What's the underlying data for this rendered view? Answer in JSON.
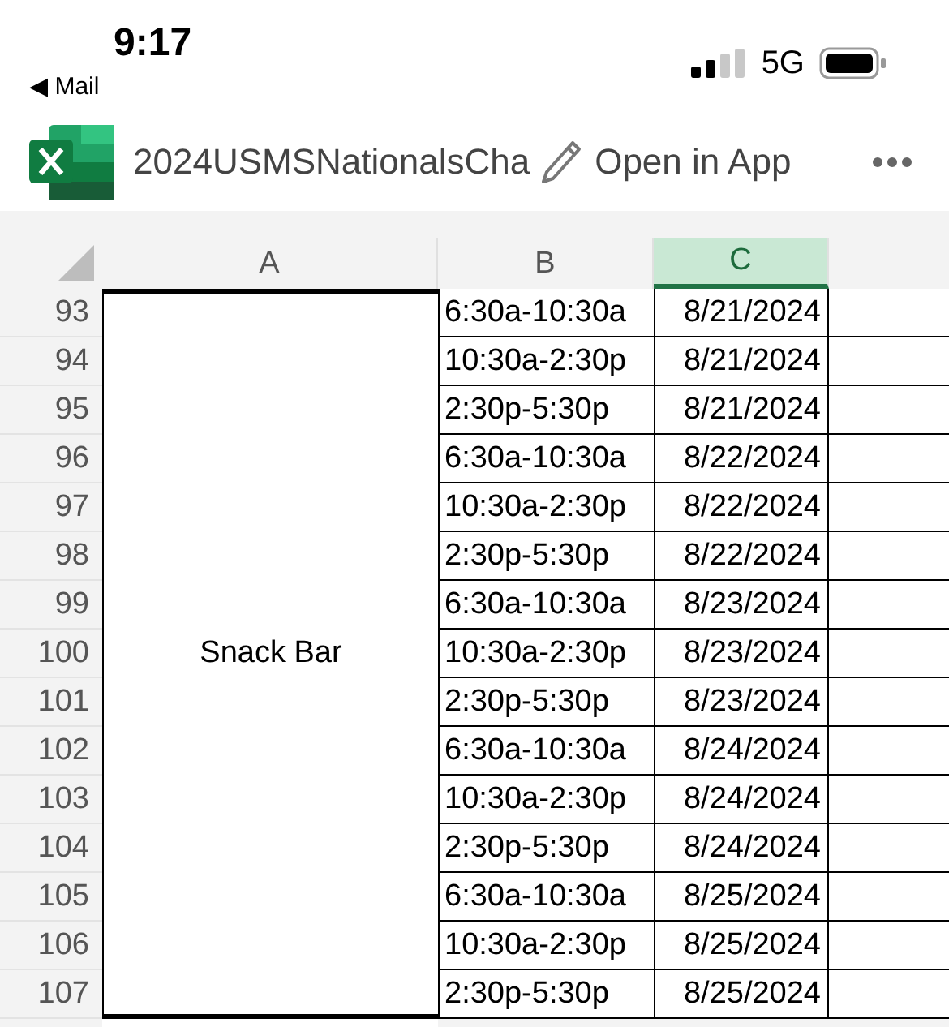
{
  "status_bar": {
    "time": "9:17",
    "back_label": "◀ Mail",
    "network": "5G"
  },
  "toolbar": {
    "title": "2024USMSNationalsCha",
    "open_button": "Open in App"
  },
  "sheet": {
    "columns": [
      {
        "label": "A",
        "selected": false
      },
      {
        "label": "B",
        "selected": false
      },
      {
        "label": "C",
        "selected": true
      }
    ],
    "merged_cell": "Snack Bar",
    "rows": [
      {
        "number": "93",
        "b": "6:30a-10:30a",
        "c": "8/21/2024"
      },
      {
        "number": "94",
        "b": "10:30a-2:30p",
        "c": "8/21/2024"
      },
      {
        "number": "95",
        "b": "2:30p-5:30p",
        "c": "8/21/2024"
      },
      {
        "number": "96",
        "b": "6:30a-10:30a",
        "c": "8/22/2024"
      },
      {
        "number": "97",
        "b": "10:30a-2:30p",
        "c": "8/22/2024"
      },
      {
        "number": "98",
        "b": "2:30p-5:30p",
        "c": "8/22/2024"
      },
      {
        "number": "99",
        "b": "6:30a-10:30a",
        "c": "8/23/2024"
      },
      {
        "number": "100",
        "b": "10:30a-2:30p",
        "c": "8/23/2024"
      },
      {
        "number": "101",
        "b": "2:30p-5:30p",
        "c": "8/23/2024"
      },
      {
        "number": "102",
        "b": "6:30a-10:30a",
        "c": "8/24/2024"
      },
      {
        "number": "103",
        "b": "10:30a-2:30p",
        "c": "8/24/2024"
      },
      {
        "number": "104",
        "b": "2:30p-5:30p",
        "c": "8/24/2024"
      },
      {
        "number": "105",
        "b": "6:30a-10:30a",
        "c": "8/25/2024"
      },
      {
        "number": "106",
        "b": "10:30a-2:30p",
        "c": "8/25/2024"
      },
      {
        "number": "107",
        "b": "2:30p-5:30p",
        "c": "8/25/2024"
      }
    ]
  }
}
